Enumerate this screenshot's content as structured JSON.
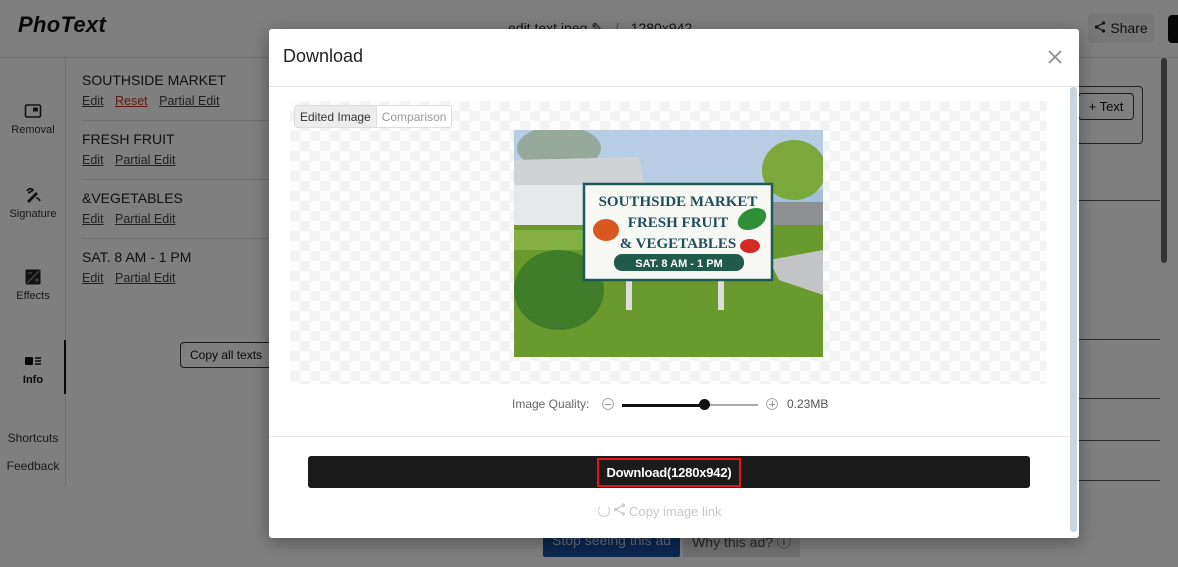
{
  "app": {
    "logo": "PhoText",
    "file_name": "edit text.jpeg",
    "file_dimensions": "1280x942",
    "share_label": "Share",
    "add_text_label": "+ Text"
  },
  "left_nav": {
    "items": [
      {
        "label": "Removal",
        "icon": "removal-icon"
      },
      {
        "label": "Signature",
        "icon": "signature-icon"
      },
      {
        "label": "Effects",
        "icon": "effects-icon"
      },
      {
        "label": "Info",
        "icon": "info-icon",
        "active": true
      }
    ],
    "links": [
      "Shortcuts",
      "Feedback"
    ]
  },
  "text_list": [
    {
      "text": "SOUTHSIDE MARKET",
      "actions": [
        "Edit",
        "Reset",
        "Partial Edit"
      ]
    },
    {
      "text": "FRESH FRUIT",
      "actions": [
        "Edit",
        "Partial Edit"
      ]
    },
    {
      "text": "&VEGETABLES",
      "actions": [
        "Edit",
        "Partial Edit"
      ]
    },
    {
      "text": "SAT. 8 AM - 1 PM",
      "actions": [
        "Edit",
        "Partial Edit"
      ]
    }
  ],
  "copy_all_label": "Copy all texts",
  "ad": {
    "stop_label": "Stop seeing this ad",
    "why_label": "Why this ad? ⓘ"
  },
  "modal": {
    "title": "Download",
    "tabs": [
      {
        "label": "Edited Image",
        "active": true
      },
      {
        "label": "Comparison",
        "active": false
      }
    ],
    "image": {
      "sign_lines": [
        "SOUTHSIDE MARKET",
        "FRESH FRUIT",
        "& VEGETABLES",
        "SAT. 8 AM - 1 PM"
      ]
    },
    "quality": {
      "label": "Image Quality:",
      "value_fraction": 0.6,
      "file_size": "0.23MB"
    },
    "download_label": "Download(1280x942)",
    "copy_link_label": "Copy image link"
  }
}
